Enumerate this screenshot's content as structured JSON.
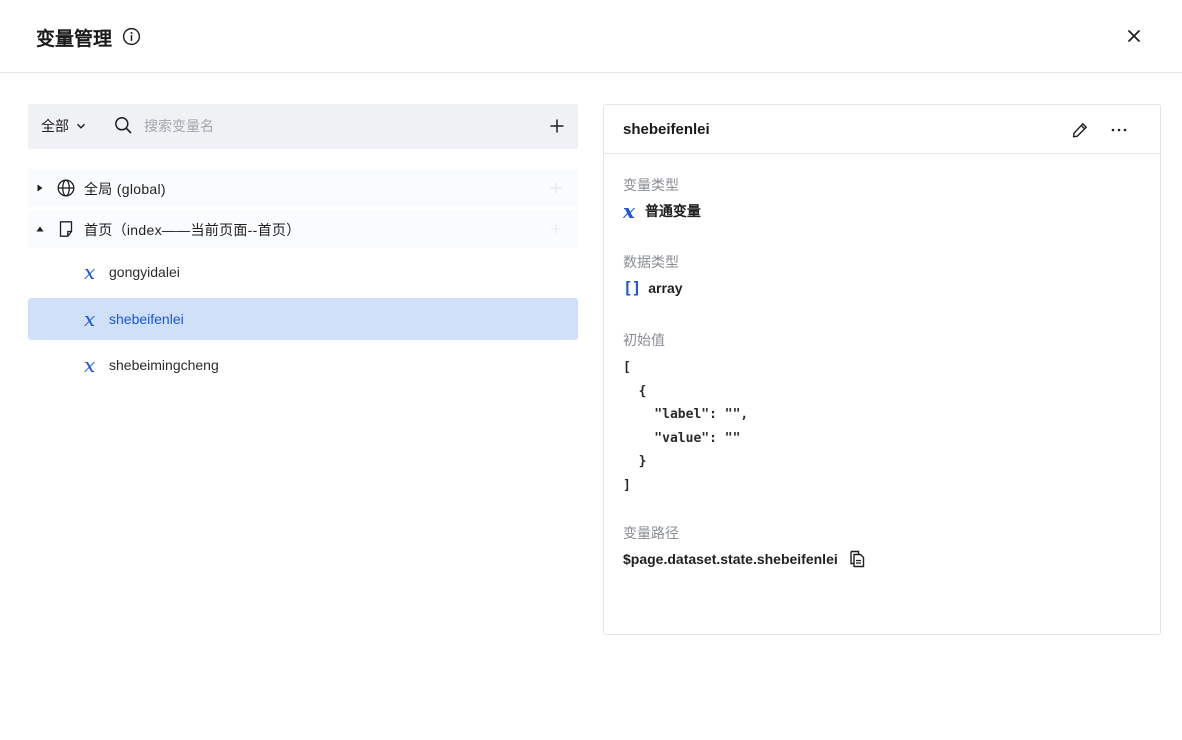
{
  "header": {
    "title": "变量管理",
    "info_icon": "info-circle-icon",
    "close_icon": "close-icon"
  },
  "toolbar": {
    "scope_value": "全部",
    "search_placeholder": "搜索变量名",
    "add_icon": "plus-icon"
  },
  "tree": {
    "groups": [
      {
        "label": "全局 (global)",
        "icon": "globe-icon",
        "expanded": false
      },
      {
        "label": "首页（index——当前页面--首页）",
        "icon": "page-icon",
        "expanded": true
      }
    ],
    "variables": [
      {
        "label": "gongyidalei",
        "icon": "x-variable-icon",
        "selected": false
      },
      {
        "label": "shebeifenlei",
        "icon": "x-variable-icon",
        "selected": true
      },
      {
        "label": "shebeimingcheng",
        "icon": "x-variable-icon",
        "selected": false
      }
    ]
  },
  "detail": {
    "title": "shebeifenlei",
    "var_type_label": "变量类型",
    "var_type_value": "普通变量",
    "data_type_label": "数据类型",
    "data_type_value": "array",
    "initial_label": "初始值",
    "initial_value": "[\n  {\n    \"label\": \"\",\n    \"value\": \"\"\n  }\n]",
    "path_label": "变量路径",
    "path_value": "$page.dataset.state.shebeifenlei"
  },
  "colors": {
    "accent": "#1a56db",
    "selected_bg": "#cfe0f8",
    "toolbar_bg": "#f0f1f5",
    "muted_text": "#8a8d93",
    "border": "#e3e5e8"
  }
}
